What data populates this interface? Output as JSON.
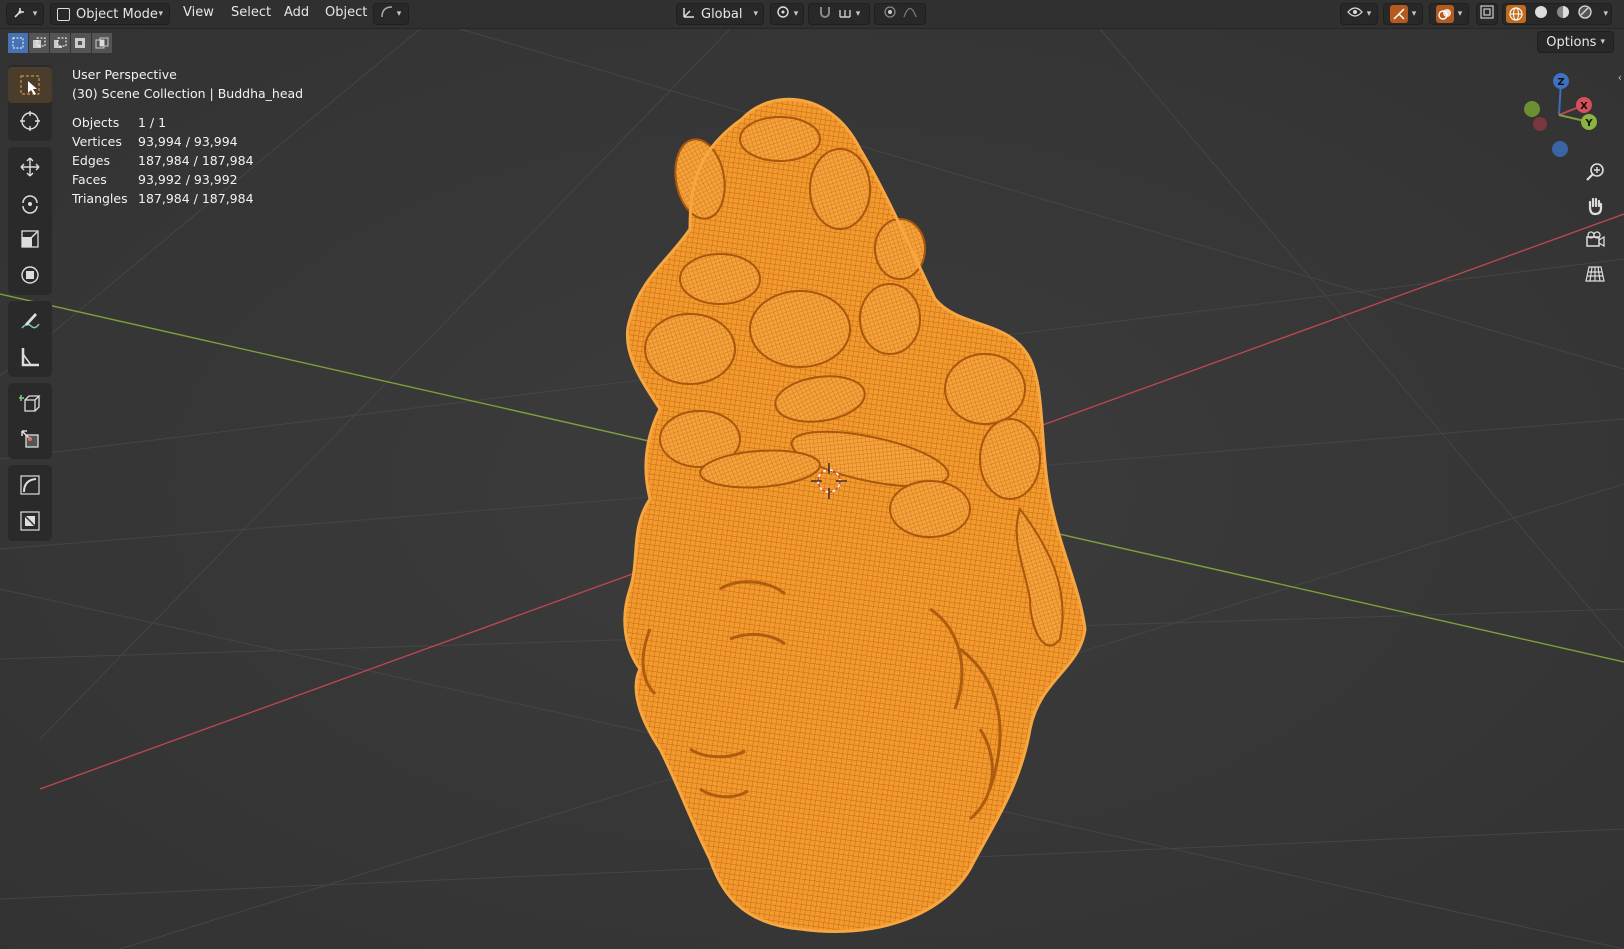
{
  "header": {
    "editor_type_icon": "editor-type-icon",
    "mode_label": "Object Mode",
    "menus": [
      "View",
      "Select",
      "Add",
      "Object"
    ],
    "orientation_label": "Global",
    "shading_modes": [
      "wireframe",
      "solid",
      "material",
      "rendered"
    ],
    "active_shading": "wireframe"
  },
  "viewport": {
    "options_label": "Options",
    "overlay": {
      "perspective": "User Perspective",
      "collection": "(30) Scene Collection | Buddha_head",
      "stats": [
        {
          "label": "Objects",
          "value": "1 / 1"
        },
        {
          "label": "Vertices",
          "value": "93,994 / 93,994"
        },
        {
          "label": "Edges",
          "value": "187,984 / 187,984"
        },
        {
          "label": "Faces",
          "value": "93,992 / 93,992"
        },
        {
          "label": "Triangles",
          "value": "187,984 / 187,984"
        }
      ]
    },
    "gizmo_axes": [
      "Z",
      "X",
      "Y"
    ],
    "tools": [
      "select-box",
      "cursor",
      "move",
      "rotate",
      "scale",
      "transform",
      "annotate",
      "measure",
      "add-cube",
      "transform-origin",
      "curve",
      "shrink-fatten"
    ],
    "nav_buttons": [
      "zoom",
      "pan",
      "camera",
      "ortho-grid"
    ],
    "colors": {
      "background": "#3a3a3a",
      "mesh_selected": "#f29a2e",
      "x_axis": "#c0484f",
      "y_axis": "#7ea03a",
      "accent": "#4772b3"
    }
  }
}
